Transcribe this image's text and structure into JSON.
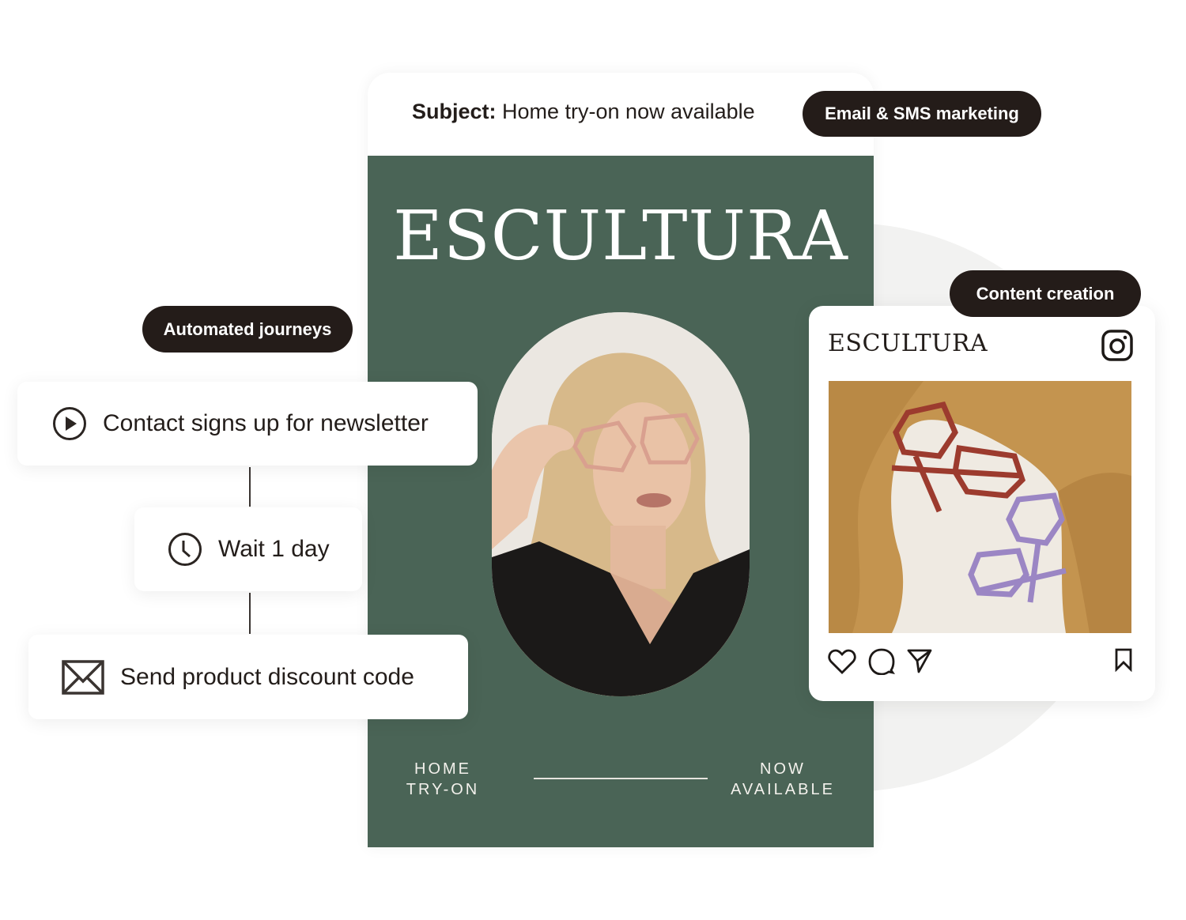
{
  "email": {
    "subject_label": "Subject:",
    "subject_text": " Home try-on now available",
    "brand": "ESCULTURA",
    "footer_left_line1": "HOME",
    "footer_left_line2": "TRY-ON",
    "footer_right_line1": "NOW",
    "footer_right_line2": "AVAILABLE",
    "body_color": "#4a6456"
  },
  "pills": {
    "email_sms": "Email & SMS marketing",
    "automated_journeys": "Automated journeys",
    "content_creation": "Content creation"
  },
  "journey": {
    "steps": [
      {
        "icon": "play-circle-icon",
        "label": "Contact signs up for newsletter"
      },
      {
        "icon": "clock-icon",
        "label": "Wait 1 day"
      },
      {
        "icon": "envelope-icon",
        "label": "Send product discount code"
      }
    ]
  },
  "instagram_post": {
    "brand": "ESCULTURA",
    "platform_icon": "instagram-icon",
    "actions": [
      "heart-icon",
      "comment-icon",
      "share-icon",
      "bookmark-icon"
    ]
  },
  "colors": {
    "pill_bg": "#241c19",
    "accent_green": "#4a6456",
    "text_dark": "#231d1a"
  }
}
